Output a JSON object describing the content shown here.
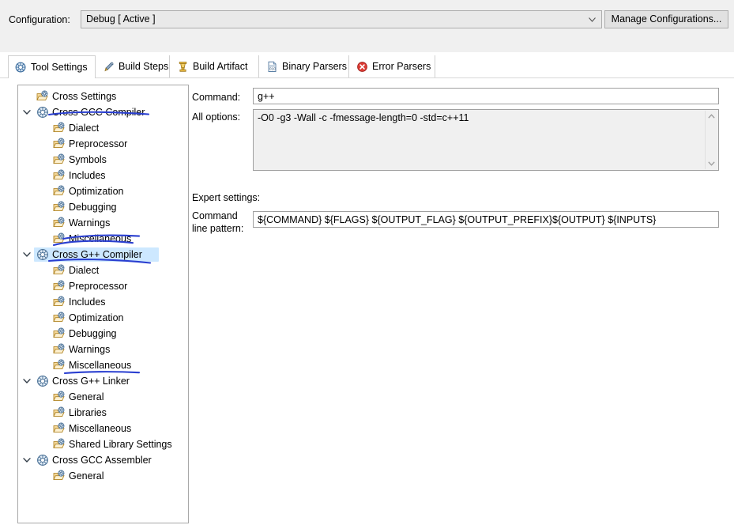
{
  "window": {
    "title": "Eclipse CDT Tool Settings",
    "accent_color": "#2a3fd0",
    "selection_color": "#cde8ff"
  },
  "config_bar": {
    "label": "Configuration:",
    "value": "Debug  [ Active ]",
    "dropdown_icon": "chevron-down-icon",
    "manage_button": "Manage Configurations..."
  },
  "tabs": [
    {
      "label": "Tool Settings",
      "icon": "tool-settings-icon",
      "active": true
    },
    {
      "label": "Build Steps",
      "icon": "build-steps-icon",
      "active": false
    },
    {
      "label": "Build Artifact",
      "icon": "build-artifact-icon",
      "active": false
    },
    {
      "label": "Binary Parsers",
      "icon": "binary-parsers-icon",
      "active": false
    },
    {
      "label": "Error Parsers",
      "icon": "error-parsers-icon",
      "active": false
    }
  ],
  "tree": [
    {
      "label": "Cross Settings",
      "level": 1,
      "icon": "settings-folder-icon",
      "expander": "none",
      "selected": false,
      "annotated": false
    },
    {
      "label": "Cross GCC Compiler",
      "level": 1,
      "icon": "compiler-icon",
      "expander": "expanded",
      "selected": false,
      "annotated": true
    },
    {
      "label": "Dialect",
      "level": 2,
      "icon": "settings-folder-icon",
      "expander": "none",
      "selected": false,
      "annotated": false
    },
    {
      "label": "Preprocessor",
      "level": 2,
      "icon": "settings-folder-icon",
      "expander": "none",
      "selected": false,
      "annotated": false
    },
    {
      "label": "Symbols",
      "level": 2,
      "icon": "settings-folder-icon",
      "expander": "none",
      "selected": false,
      "annotated": false
    },
    {
      "label": "Includes",
      "level": 2,
      "icon": "settings-folder-icon",
      "expander": "none",
      "selected": false,
      "annotated": false
    },
    {
      "label": "Optimization",
      "level": 2,
      "icon": "settings-folder-icon",
      "expander": "none",
      "selected": false,
      "annotated": false
    },
    {
      "label": "Debugging",
      "level": 2,
      "icon": "settings-folder-icon",
      "expander": "none",
      "selected": false,
      "annotated": false
    },
    {
      "label": "Warnings",
      "level": 2,
      "icon": "settings-folder-icon",
      "expander": "none",
      "selected": false,
      "annotated": false
    },
    {
      "label": "Miscellaneous",
      "level": 2,
      "icon": "settings-folder-icon",
      "expander": "none",
      "selected": false,
      "annotated": true
    },
    {
      "label": "Cross G++ Compiler",
      "level": 1,
      "icon": "compiler-icon",
      "expander": "expanded",
      "selected": true,
      "annotated": true
    },
    {
      "label": "Dialect",
      "level": 2,
      "icon": "settings-folder-icon",
      "expander": "none",
      "selected": false,
      "annotated": false
    },
    {
      "label": "Preprocessor",
      "level": 2,
      "icon": "settings-folder-icon",
      "expander": "none",
      "selected": false,
      "annotated": false
    },
    {
      "label": "Includes",
      "level": 2,
      "icon": "settings-folder-icon",
      "expander": "none",
      "selected": false,
      "annotated": false
    },
    {
      "label": "Optimization",
      "level": 2,
      "icon": "settings-folder-icon",
      "expander": "none",
      "selected": false,
      "annotated": false
    },
    {
      "label": "Debugging",
      "level": 2,
      "icon": "settings-folder-icon",
      "expander": "none",
      "selected": false,
      "annotated": false
    },
    {
      "label": "Warnings",
      "level": 2,
      "icon": "settings-folder-icon",
      "expander": "none",
      "selected": false,
      "annotated": false
    },
    {
      "label": "Miscellaneous",
      "level": 2,
      "icon": "settings-folder-icon",
      "expander": "none",
      "selected": false,
      "annotated": true
    },
    {
      "label": "Cross G++ Linker",
      "level": 1,
      "icon": "compiler-icon",
      "expander": "expanded",
      "selected": false,
      "annotated": false
    },
    {
      "label": "General",
      "level": 2,
      "icon": "settings-folder-icon",
      "expander": "none",
      "selected": false,
      "annotated": false
    },
    {
      "label": "Libraries",
      "level": 2,
      "icon": "settings-folder-icon",
      "expander": "none",
      "selected": false,
      "annotated": false
    },
    {
      "label": "Miscellaneous",
      "level": 2,
      "icon": "settings-folder-icon",
      "expander": "none",
      "selected": false,
      "annotated": false
    },
    {
      "label": "Shared Library Settings",
      "level": 2,
      "icon": "settings-folder-icon",
      "expander": "none",
      "selected": false,
      "annotated": false
    },
    {
      "label": "Cross GCC Assembler",
      "level": 1,
      "icon": "compiler-icon",
      "expander": "expanded",
      "selected": false,
      "annotated": false
    },
    {
      "label": "General",
      "level": 2,
      "icon": "settings-folder-icon",
      "expander": "none",
      "selected": false,
      "annotated": false
    }
  ],
  "settings": {
    "command_label": "Command:",
    "command_value": "g++",
    "all_options_label": "All options:",
    "all_options_value": "-O0 -g3 -Wall -c -fmessage-length=0 -std=c++11",
    "expert_settings_label": "Expert settings:",
    "command_line_pattern_label_1": "Command",
    "command_line_pattern_label_2": "line pattern:",
    "command_line_pattern_value": "${COMMAND} ${FLAGS} ${OUTPUT_FLAG} ${OUTPUT_PREFIX}${OUTPUT} ${INPUTS}",
    "scroll_up_icon": "chevron-up-icon",
    "scroll_down_icon": "chevron-down-icon"
  }
}
